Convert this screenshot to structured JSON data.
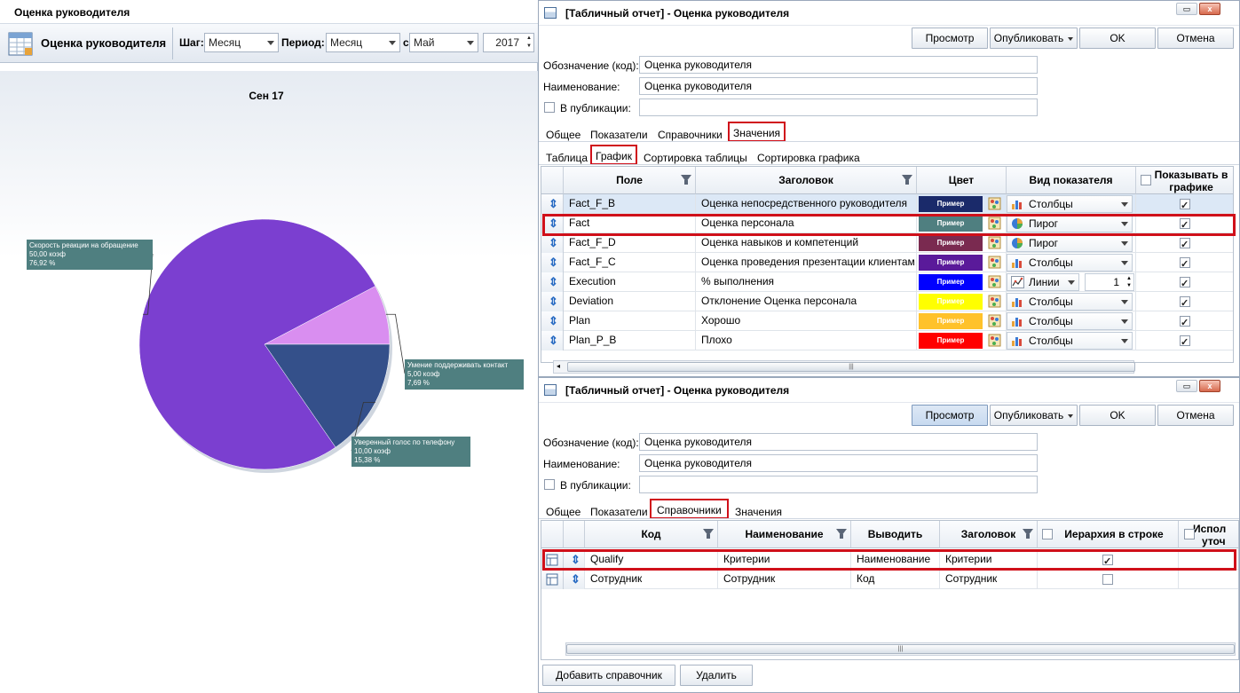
{
  "left": {
    "title": "Оценка руководителя",
    "toolbar": {
      "report_name": "Оценка руководителя",
      "step_label": "Шаг:",
      "step_value": "Месяц",
      "period_label": "Период:",
      "period_value": "Месяц",
      "from_label": "с",
      "month_value": "Май",
      "year_value": "2017"
    },
    "chart_data": {
      "type": "pie",
      "title": "Сен 17",
      "slices": [
        {
          "label": "Скорость реакции на обращение",
          "value": 50.0,
          "unit": "коэф",
          "percent": "76,92 %",
          "value_text": "50,00 коэф",
          "color": "#7b3fd0"
        },
        {
          "label": "Умение поддерживать контакт",
          "value": 5.0,
          "unit": "коэф",
          "percent": "7,69 %",
          "value_text": "5,00 коэф",
          "color": "#d98ef0"
        },
        {
          "label": "Уверенный голос по телефону",
          "value": 10.0,
          "unit": "коэф",
          "percent": "15,38 %",
          "value_text": "10,00 коэф",
          "color": "#34508a"
        }
      ]
    }
  },
  "top_dialog": {
    "title": "[Табличный отчет] - Оценка руководителя",
    "buttons": {
      "preview": "Просмотр",
      "publish": "Опубликовать",
      "ok": "OK",
      "cancel": "Отмена"
    },
    "code_label": "Обозначение (код):",
    "code_value": "Оценка руководителя",
    "name_label": "Наименование:",
    "name_value": "Оценка руководителя",
    "publish_label": "В публикации:",
    "tabs": [
      "Общее",
      "Показатели",
      "Справочники",
      "Значения"
    ],
    "subtabs": [
      "Таблица",
      "График",
      "Сортировка таблицы",
      "Сортировка графика"
    ],
    "columns": [
      "Поле",
      "Заголовок",
      "Цвет",
      "Вид показателя",
      "Показывать в графике"
    ],
    "sample_label": "Пример",
    "rows": [
      {
        "field": "Fact_F_B",
        "title": "Оценка непосредственного руководителя",
        "color": "#1a2a6a",
        "kind": "Столбцы",
        "icon": "bar-chart-icon",
        "show": true
      },
      {
        "field": "Fact",
        "title": "Оценка персонала",
        "color": "#4f7f80",
        "kind": "Пирог",
        "icon": "pie-chart-icon",
        "show": true
      },
      {
        "field": "Fact_F_D",
        "title": "Оценка навыков и компетенций",
        "color": "#7a2a50",
        "kind": "Пирог",
        "icon": "pie-chart-icon",
        "show": true
      },
      {
        "field": "Fact_F_C",
        "title": "Оценка проведения презентации клиентам",
        "color": "#5a1a9a",
        "kind": "Столбцы",
        "icon": "bar-chart-icon",
        "show": true
      },
      {
        "field": "Execution",
        "title": "% выполнения",
        "color": "#0000ff",
        "kind": "Линии",
        "icon": "line-chart-icon",
        "spin": "1",
        "show": true
      },
      {
        "field": "Deviation",
        "title": "Отклонение Оценка персонала",
        "color": "#ffff00",
        "kind": "Столбцы",
        "icon": "bar-chart-icon",
        "show": true
      },
      {
        "field": "Plan",
        "title": "Хорошо",
        "color": "#ffc22a",
        "kind": "Столбцы",
        "icon": "bar-chart-icon",
        "show": true
      },
      {
        "field": "Plan_P_B",
        "title": "Плохо",
        "color": "#ff0000",
        "kind": "Столбцы",
        "icon": "bar-chart-icon",
        "show": true
      }
    ]
  },
  "bottom_dialog": {
    "title": "[Табличный отчет] - Оценка руководителя",
    "buttons": {
      "preview": "Просмотр",
      "publish": "Опубликовать",
      "ok": "OK",
      "cancel": "Отмена"
    },
    "code_label": "Обозначение (код):",
    "code_value": "Оценка руководителя",
    "name_label": "Наименование:",
    "name_value": "Оценка руководителя",
    "publish_label": "В публикации:",
    "tabs": [
      "Общее",
      "Показатели",
      "Справочники",
      "Значения"
    ],
    "columns": [
      "Код",
      "Наименование",
      "Выводить",
      "Заголовок",
      "Иерархия в строке",
      "Испол",
      "уточ"
    ],
    "rows": [
      {
        "code": "Qualify",
        "name": "Критерии",
        "output": "Наименование",
        "title": "Критерии",
        "hierarchy": true
      },
      {
        "code": "Сотрудник",
        "name": "Сотрудник",
        "output": "Код",
        "title": "Сотрудник",
        "hierarchy": false
      }
    ],
    "add_button": "Добавить справочник",
    "delete_button": "Удалить"
  },
  "colors": {
    "highlight": "#d0101a",
    "accent": "#2a6cc3"
  }
}
